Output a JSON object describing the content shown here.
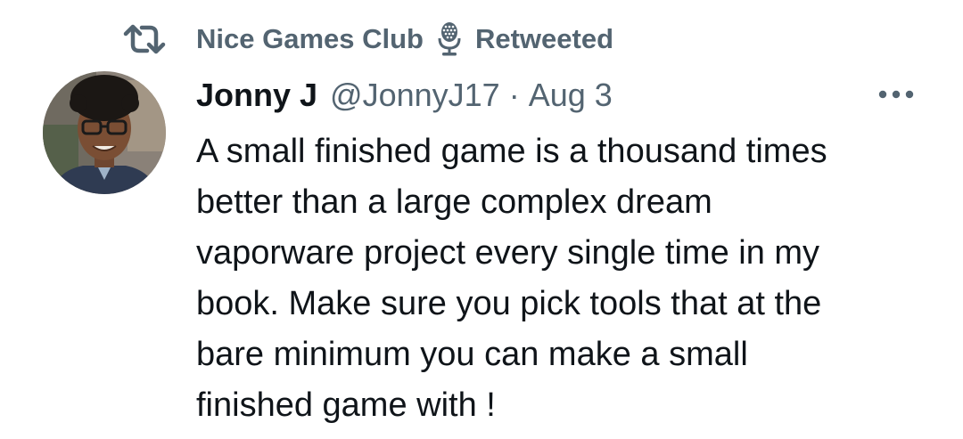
{
  "social_context": {
    "retweeter": "Nice Games Club",
    "action": "Retweeted",
    "icons": [
      "retweet-icon",
      "microphone-icon"
    ]
  },
  "tweet": {
    "display_name": "Jonny J",
    "handle": "@JonnyJ17",
    "separator": "·",
    "date": "Aug 3",
    "text": "A small finished game is a thousand times\nbetter than a large complex dream\nvaporware project every single time in my\nbook. Make sure you pick tools that at the\nbare minimum you can make a small\nfinished game with !",
    "more_icon": "more-icon"
  },
  "colors": {
    "text_primary": "#0f1419",
    "text_secondary": "#536471",
    "background": "#ffffff"
  }
}
